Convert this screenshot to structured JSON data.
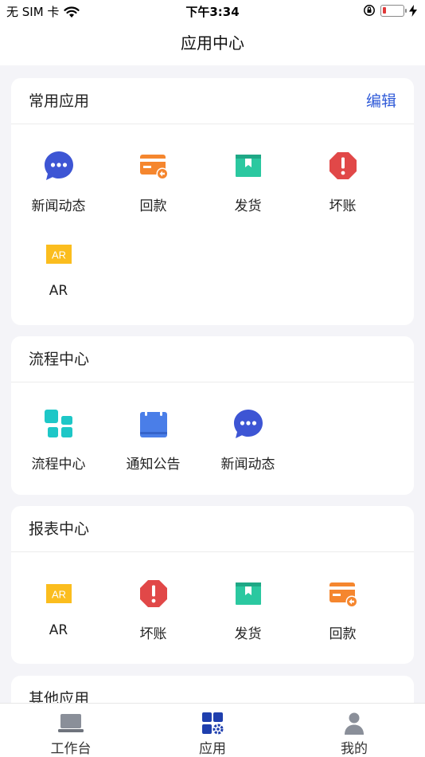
{
  "status": {
    "carrier": "无 SIM 卡",
    "time": "下午3:34",
    "battery_level": 0.18
  },
  "nav": {
    "title": "应用中心"
  },
  "sections": [
    {
      "title": "常用应用",
      "action": "编辑",
      "items": [
        {
          "label": "新闻动态",
          "icon": "chat-bubble-icon"
        },
        {
          "label": "回款",
          "icon": "payment-card-icon"
        },
        {
          "label": "发货",
          "icon": "delivery-box-icon"
        },
        {
          "label": "坏账",
          "icon": "alert-octagon-icon"
        },
        {
          "label": "AR",
          "icon": "ar-badge-icon",
          "badge": "AR"
        }
      ]
    },
    {
      "title": "流程中心",
      "items": [
        {
          "label": "流程中心",
          "icon": "blocks-icon"
        },
        {
          "label": "通知公告",
          "icon": "calendar-notice-icon"
        },
        {
          "label": "新闻动态",
          "icon": "chat-bubble-icon"
        }
      ]
    },
    {
      "title": "报表中心",
      "items": [
        {
          "label": "AR",
          "icon": "ar-badge-icon",
          "badge": "AR"
        },
        {
          "label": "坏账",
          "icon": "alert-octagon-icon"
        },
        {
          "label": "发货",
          "icon": "delivery-box-icon"
        },
        {
          "label": "回款",
          "icon": "payment-card-icon"
        }
      ]
    },
    {
      "title": "其他应用",
      "items": []
    }
  ],
  "tabs": [
    {
      "label": "工作台",
      "icon": "laptop-icon",
      "active": false
    },
    {
      "label": "应用",
      "icon": "apps-grid-icon",
      "active": true
    },
    {
      "label": "我的",
      "icon": "user-icon",
      "active": false
    }
  ],
  "colors": {
    "accent": "#2f5ad8",
    "chat": "#3d55d4",
    "payment": "#f5862e",
    "delivery": "#2bc8a0",
    "alert": "#e14848",
    "ar": "#fbbd1e",
    "blocks": "#1ec7c7",
    "notice": "#4a7ee8"
  }
}
